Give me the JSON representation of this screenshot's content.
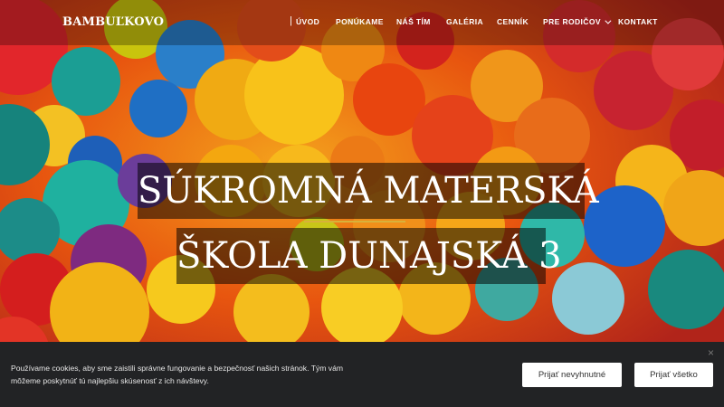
{
  "header": {
    "logo": "BAMBUĽKOVO",
    "separator": "|",
    "nav": [
      {
        "label": "ÚVOD"
      },
      {
        "label": "PONÚKAME"
      },
      {
        "label": "NÁŠ TÍM"
      },
      {
        "label": "GALÉRIA"
      },
      {
        "label": "CENNÍK"
      },
      {
        "label": "PRE RODIČOV",
        "dropdown": true
      },
      {
        "label": "KONTAKT"
      }
    ]
  },
  "hero": {
    "title_line1": "SÚKROMNÁ MATERSKÁ",
    "title_line2": "ŠKOLA DUNAJSKÁ 3",
    "accent_color": "#d8b13a"
  },
  "cookie": {
    "text": "Používame cookies, aby sme zaistili správne fungovanie a bezpečnosť našich stránok. Tým vám môžeme poskytnúť tú najlepšiu skúsenosť z ich návštevy.",
    "accept_necessary": "Prijať nevyhnutné",
    "accept_all": "Prijať všetko",
    "close_icon": "×"
  }
}
